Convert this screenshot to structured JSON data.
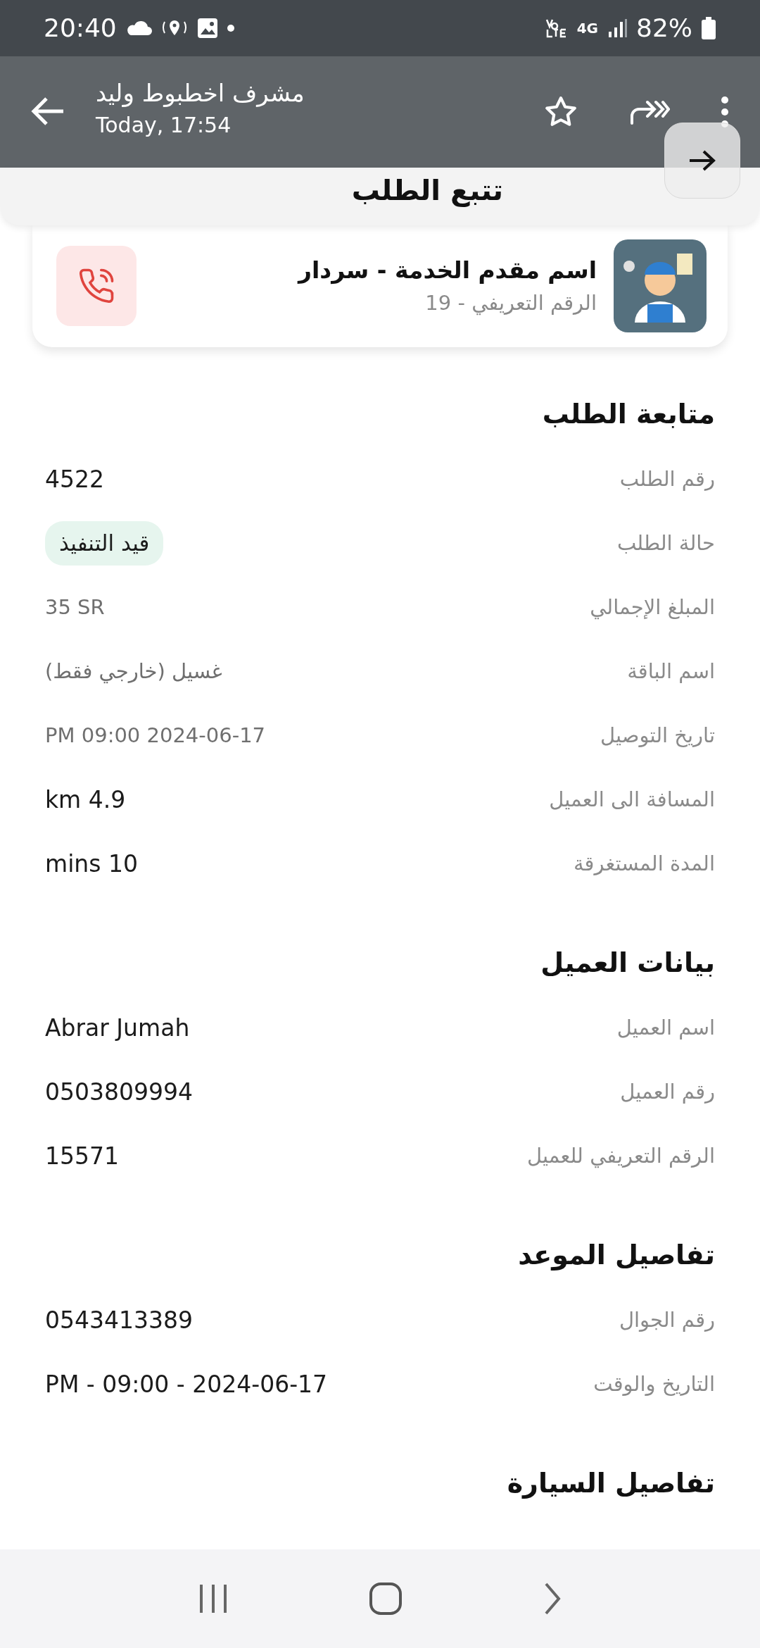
{
  "status_bar": {
    "time": "20:40",
    "network": "4G",
    "battery": "82%"
  },
  "app_bar": {
    "title": "مشرف اخطبوط وليد",
    "subtitle": "Today, 17:54"
  },
  "sheet": {
    "title": "تتبع الطلب"
  },
  "provider": {
    "name": "اسم مقدم الخدمة - سردار",
    "id": "الرقم التعريفي - 19"
  },
  "sections": [
    {
      "title": "متابعة الطلب",
      "rows": [
        {
          "label": "رقم الطلب",
          "value": "4522",
          "kind": "text"
        },
        {
          "label": "حالة الطلب",
          "value": "قيد التنفيذ",
          "kind": "badge"
        },
        {
          "label": "المبلغ الإجمالي",
          "value": "35 SR",
          "kind": "muted"
        },
        {
          "label": "اسم الباقة",
          "value": "غسيل (خارجي فقط)",
          "kind": "muted"
        },
        {
          "label": "تاريخ التوصيل",
          "value": "PM 09:00 2024-06-17",
          "kind": "muted"
        },
        {
          "label": "المسافة الى العميل",
          "value": "km 4.9",
          "kind": "text"
        },
        {
          "label": "المدة المستغرقة",
          "value": "mins 10",
          "kind": "text"
        }
      ]
    },
    {
      "title": "بيانات العميل",
      "rows": [
        {
          "label": "اسم العميل",
          "value": "Abrar Jumah",
          "kind": "text"
        },
        {
          "label": "رقم العميل",
          "value": "0503809994",
          "kind": "text"
        },
        {
          "label": "الرقم التعريفي للعميل",
          "value": "15571",
          "kind": "text"
        }
      ]
    },
    {
      "title": "تفاصيل الموعد",
      "rows": [
        {
          "label": "رقم الجوال",
          "value": "0543413389",
          "kind": "text"
        },
        {
          "label": "التاريخ والوقت",
          "value": "PM - 09:00 - 2024-06-17",
          "kind": "text"
        }
      ]
    },
    {
      "title": "تفاصيل السيارة"
    }
  ]
}
